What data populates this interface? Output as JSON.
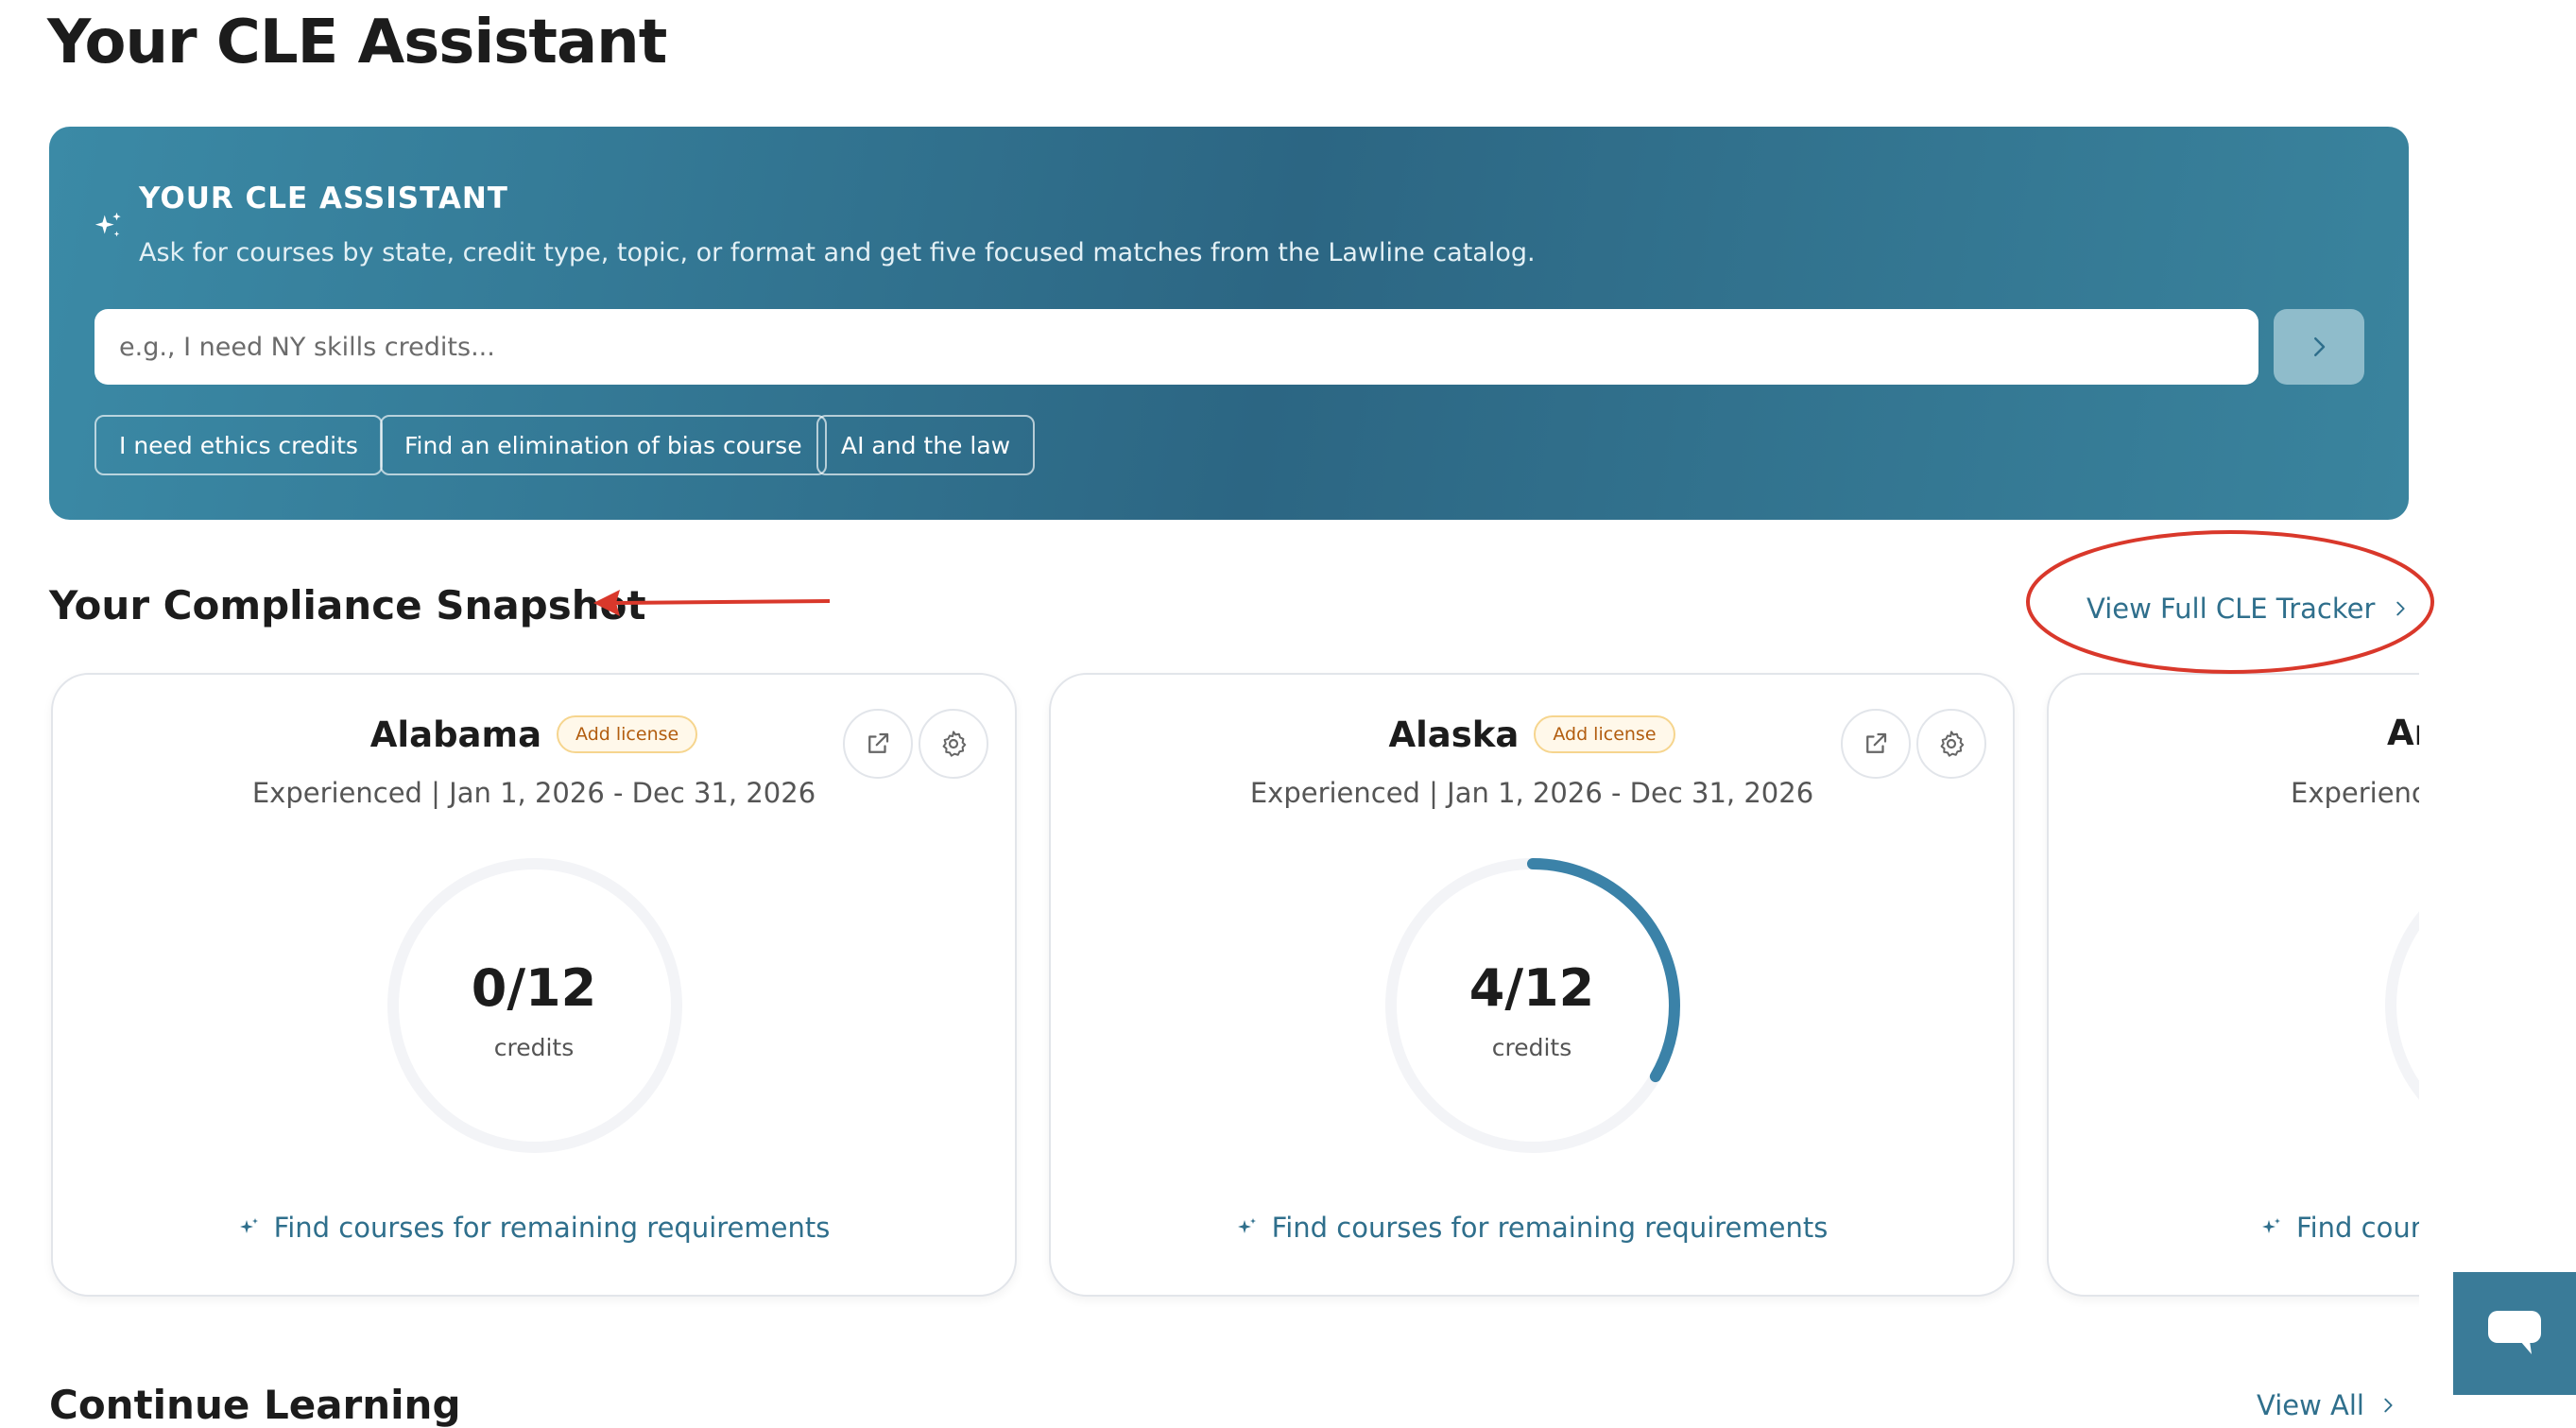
{
  "page": {
    "title": "Your CLE Assistant"
  },
  "assistant": {
    "heading": "YOUR CLE ASSISTANT",
    "subtitle": "Ask for courses by state, credit type, topic, or format and get five focused matches from the Lawline catalog.",
    "input_placeholder": "e.g., I need NY skills credits...",
    "input_value": "",
    "suggestions": [
      "I need ethics credits",
      "Find an elimination of bias course",
      "AI and the law"
    ],
    "sparkle_icon": "sparkle-icon",
    "submit_icon": "chevron-right-icon"
  },
  "snapshot": {
    "title": "Your Compliance Snapshot",
    "view_tracker_label": "View Full CLE Tracker",
    "cards": [
      {
        "state": "Alabama",
        "badge": "Add license",
        "period": "Experienced | Jan 1, 2026 - Dec 31, 2026",
        "credits_text": "0/12",
        "credits_label": "credits",
        "progress": 0,
        "find_link": "Find courses for remaining requirements"
      },
      {
        "state": "Alaska",
        "badge": "Add license",
        "period": "Experienced | Jan 1, 2026 - Dec 31, 2026",
        "credits_text": "4/12",
        "credits_label": "credits",
        "progress": 0.3333,
        "find_link": "Find courses for remaining requirements"
      },
      {
        "state_partial": "Ar",
        "period_partial": "Experience",
        "find_link_partial": "Find cours"
      }
    ]
  },
  "continue_learning": {
    "title": "Continue Learning",
    "view_all_label": "View All"
  },
  "colors": {
    "accent": "#2f6f8c",
    "panel_gradient_start": "#3b8aa6",
    "panel_gradient_mid": "#2c6683",
    "progress_ring": "#3b82a8",
    "ring_track": "#f3f4f7",
    "badge_text": "#b25d0f",
    "badge_border": "#f6d58e",
    "annotation_red": "#d9382b"
  }
}
